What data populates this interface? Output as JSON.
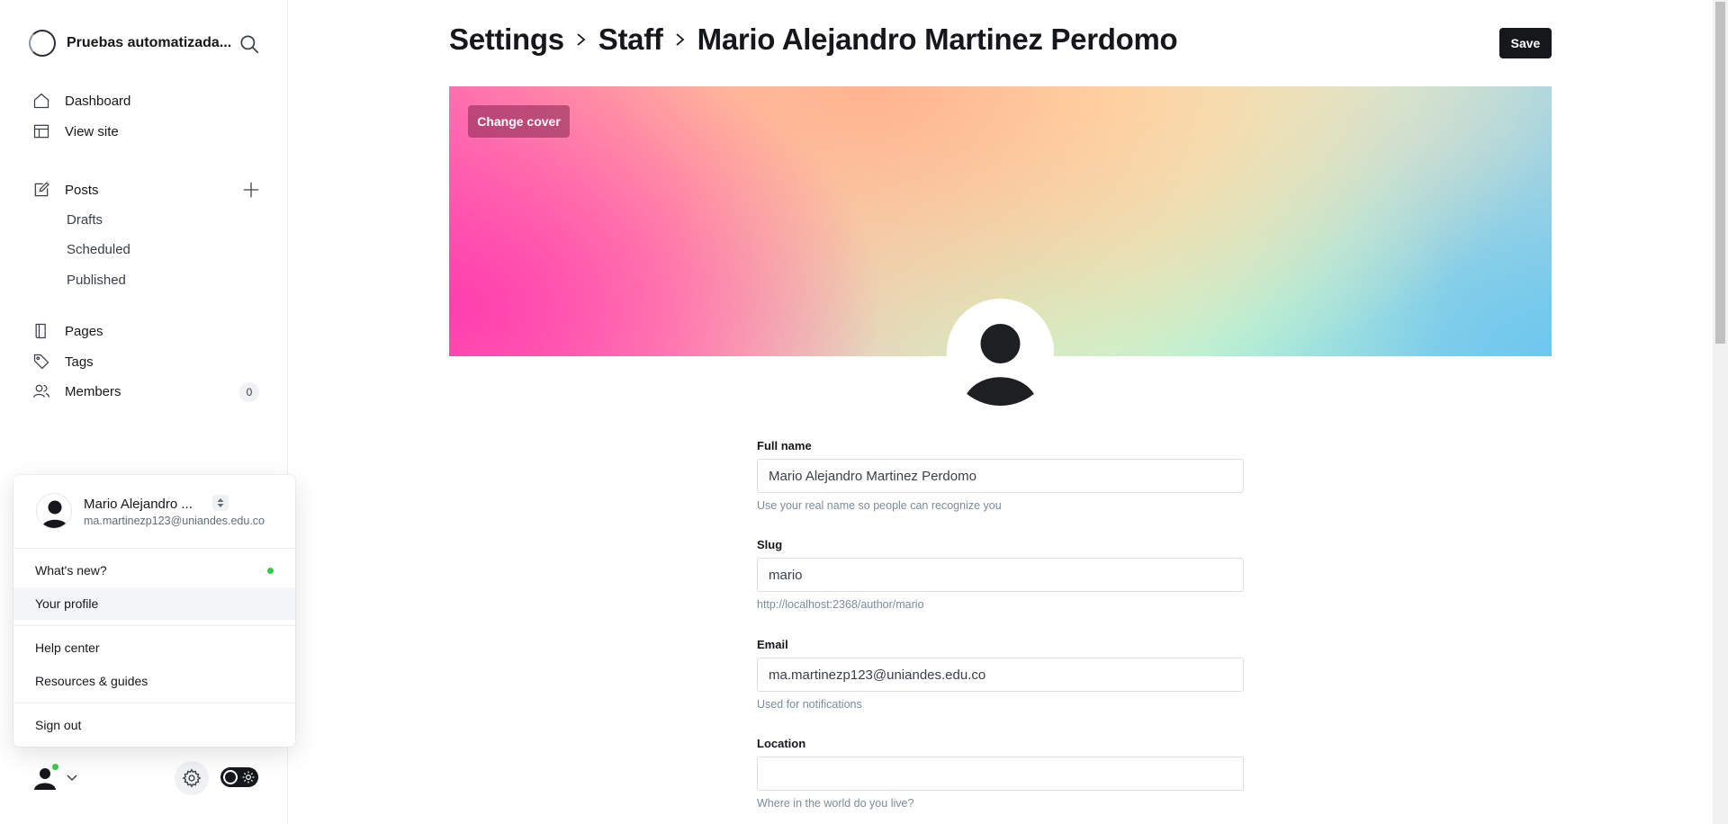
{
  "sidebar": {
    "brand_name": "Pruebas automatizada...",
    "nav": {
      "dashboard": "Dashboard",
      "view_site": "View site",
      "posts": "Posts",
      "drafts": "Drafts",
      "scheduled": "Scheduled",
      "published": "Published",
      "pages": "Pages",
      "tags": "Tags",
      "members": "Members",
      "members_count": "0"
    }
  },
  "user_menu": {
    "name": "Mario Alejandro ...",
    "email": "ma.martinezp123@uniandes.edu.co",
    "items": {
      "whats_new": "What's new?",
      "your_profile": "Your profile",
      "help_center": "Help center",
      "resources": "Resources & guides",
      "sign_out": "Sign out"
    }
  },
  "header": {
    "crumb_1": "Settings",
    "crumb_2": "Staff",
    "crumb_3": "Mario Alejandro Martinez Perdomo",
    "save_label": "Save"
  },
  "cover": {
    "change_cover_label": "Change cover"
  },
  "form": {
    "full_name": {
      "label": "Full name",
      "value": "Mario Alejandro Martinez Perdomo",
      "hint": "Use your real name so people can recognize you"
    },
    "slug": {
      "label": "Slug",
      "value": "mario",
      "hint": "http://localhost:2368/author/mario"
    },
    "email": {
      "label": "Email",
      "value": "ma.martinezp123@uniandes.edu.co",
      "hint": "Used for notifications"
    },
    "location": {
      "label": "Location",
      "value": "",
      "hint": "Where in the world do you live?"
    }
  },
  "colors": {
    "accent_dark": "#15171a",
    "online_green": "#30cf43"
  }
}
